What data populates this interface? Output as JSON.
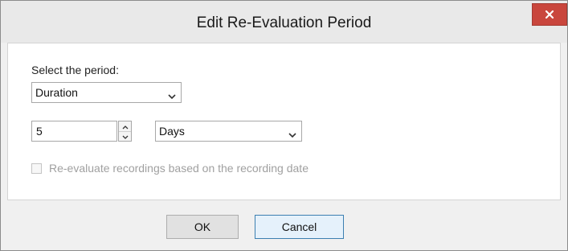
{
  "dialog": {
    "title": "Edit Re-Evaluation Period",
    "close_label": "x"
  },
  "form": {
    "period_label": "Select the period:",
    "period_select": {
      "selected": "Duration"
    },
    "duration_value": "5",
    "unit_select": {
      "selected": "Days"
    },
    "reevaluate_checkbox": {
      "label": "Re-evaluate recordings based on the recording date",
      "checked": false,
      "enabled": false
    }
  },
  "buttons": {
    "ok_label": "OK",
    "cancel_label": "Cancel"
  },
  "colors": {
    "close_button": "#c9463d",
    "disabled_text": "#a0a0a0",
    "focused_button_border": "#3c7fb1"
  },
  "icons": {
    "close": "close-icon",
    "dropdown": "chevron-down-icon",
    "spin_up": "spin-up-icon",
    "spin_down": "spin-down-icon"
  }
}
